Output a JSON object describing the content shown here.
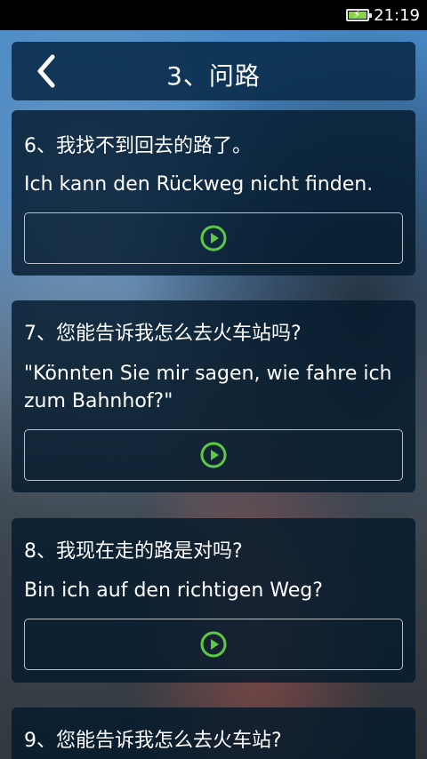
{
  "status_bar": {
    "time": "21:19",
    "battery_level": 0.9,
    "battery_color": "#8bd146"
  },
  "header": {
    "title": "3、问路",
    "back_icon": "chevron-left-icon"
  },
  "phrases": [
    {
      "cn": "6、我找不到回去的路了。",
      "de": "Ich kann den Rückweg nicht finden.",
      "play_icon": "play-circle-icon"
    },
    {
      "cn": "7、您能告诉我怎么去火车站吗?",
      "de": "\"Könnten Sie mir sagen, wie fahre ich zum Bahnhof?\"",
      "play_icon": "play-circle-icon"
    },
    {
      "cn": "8、我现在走的路是对吗?",
      "de": "Bin ich auf den richtigen Weg?",
      "play_icon": "play-circle-icon"
    },
    {
      "cn": "9、您能告诉我怎么去火车站?"
    }
  ],
  "colors": {
    "accent_green": "#5cc846",
    "header_bg": "#082a48"
  }
}
